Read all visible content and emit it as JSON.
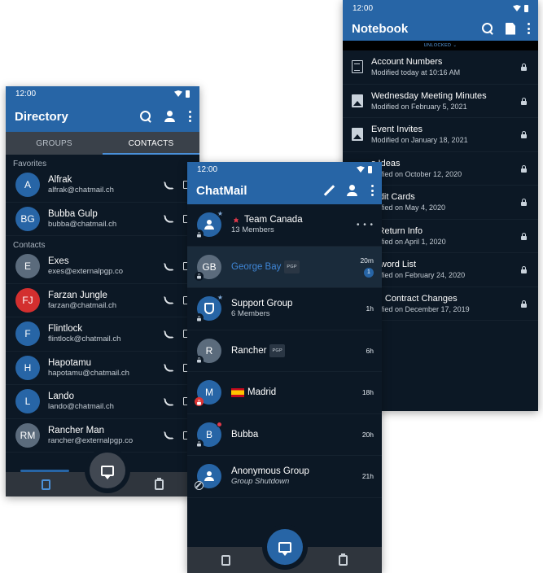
{
  "directory": {
    "status_time": "12:00",
    "title": "Directory",
    "tabs": [
      {
        "label": "GROUPS",
        "active": false
      },
      {
        "label": "CONTACTS",
        "active": true
      }
    ],
    "favorites_label": "Favorites",
    "contacts_label": "Contacts",
    "favorites": [
      {
        "initials": "A",
        "name": "Alfrak",
        "email": "alfrak@chatmail.ch",
        "color": "#2765a6"
      },
      {
        "initials": "BG",
        "name": "Bubba Gulp",
        "email": "bubba@chatmail.ch",
        "color": "#2765a6"
      }
    ],
    "contacts": [
      {
        "initials": "E",
        "name": "Exes",
        "email": "exes@externalpgp.co",
        "color": "#5b6b7c"
      },
      {
        "initials": "FJ",
        "name": "Farzan Jungle",
        "email": "farzan@chatmail.ch",
        "color": "#d32f2f"
      },
      {
        "initials": "F",
        "name": "Flintlock",
        "email": "flintlock@chatmail.ch",
        "color": "#2765a6"
      },
      {
        "initials": "H",
        "name": "Hapotamu",
        "email": "hapotamu@chatmail.ch",
        "color": "#2765a6"
      },
      {
        "initials": "L",
        "name": "Lando",
        "email": "lando@chatmail.ch",
        "color": "#2765a6"
      },
      {
        "initials": "RM",
        "name": "Rancher Man",
        "email": "rancher@externalpgp.co",
        "color": "#5b6b7c"
      }
    ]
  },
  "notebook": {
    "status_time": "12:00",
    "title": "Notebook",
    "lock_state": "UNLOCKED",
    "notes": [
      {
        "icon": "lines",
        "title": "Account Numbers",
        "subtitle": "Modified today at 10:16 AM"
      },
      {
        "icon": "image",
        "title": "Wednesday Meeting Minutes",
        "subtitle": "Modified on February 5, 2021"
      },
      {
        "icon": "image",
        "title": "Event Invites",
        "subtitle": "Modified on January 18, 2021"
      },
      {
        "icon": "none",
        "title": "s Ideas",
        "subtitle": "odified on October 12, 2020"
      },
      {
        "icon": "none",
        "title": "redit Cards",
        "subtitle": "odified on May 4, 2020"
      },
      {
        "icon": "none",
        "title": "x Return Info",
        "subtitle": "odified on April 1, 2020"
      },
      {
        "icon": "none",
        "title": "ssword List",
        "subtitle": "odified on February 24, 2020"
      },
      {
        "icon": "none",
        "title": "ov. Contract Changes",
        "subtitle": "odified on December 17, 2019"
      }
    ]
  },
  "chatmail": {
    "status_time": "12:00",
    "title": "ChatMail",
    "chats": [
      {
        "avatar_type": "group",
        "initials": "",
        "flag": "canada",
        "name": "Team Canada",
        "subtitle": "13 Members",
        "time": "",
        "pgp": false,
        "unread": "",
        "badge": "lock",
        "selected": false,
        "more": true,
        "avatar_color": "#2765a6"
      },
      {
        "avatar_type": "initials",
        "initials": "GB",
        "flag": "",
        "name": "George Bay",
        "subtitle": "",
        "time": "20m",
        "pgp": true,
        "unread": "1",
        "badge": "lock",
        "selected": true,
        "more": false,
        "avatar_color": "#5b6b7c"
      },
      {
        "avatar_type": "shield",
        "initials": "",
        "flag": "",
        "name": "Support Group",
        "subtitle": "6 Members",
        "time": "1h",
        "pgp": false,
        "unread": "",
        "badge": "lock",
        "selected": false,
        "more": false,
        "avatar_color": "#2765a6"
      },
      {
        "avatar_type": "initials",
        "initials": "R",
        "flag": "",
        "name": "Rancher",
        "subtitle": "",
        "time": "6h",
        "pgp": true,
        "unread": "",
        "badge": "lock",
        "selected": false,
        "more": false,
        "avatar_color": "#5b6b7c"
      },
      {
        "avatar_type": "initials",
        "initials": "M",
        "flag": "spain",
        "name": "Madrid",
        "subtitle": "",
        "time": "18h",
        "pgp": false,
        "unread": "",
        "badge": "lock-red",
        "selected": false,
        "more": false,
        "avatar_color": "#2765a6"
      },
      {
        "avatar_type": "initials",
        "initials": "B",
        "flag": "",
        "name": "Bubba",
        "subtitle": "",
        "time": "20h",
        "pgp": false,
        "unread": "",
        "badge": "lock",
        "selected": false,
        "more": false,
        "avatar_color": "#2765a6",
        "dot": true
      },
      {
        "avatar_type": "group",
        "initials": "",
        "flag": "",
        "name": "Anonymous Group",
        "subtitle": "Group Shutdown",
        "time": "21h",
        "pgp": false,
        "unread": "",
        "badge": "block",
        "selected": false,
        "more": false,
        "avatar_color": "#2765a6",
        "italic_sub": true
      }
    ],
    "pgp_label": "PGP"
  },
  "colors": {
    "brand_blue": "#2765a6",
    "background": "#0c1825",
    "nav_bar": "#2f353d",
    "link_blue": "#3f86d6"
  }
}
